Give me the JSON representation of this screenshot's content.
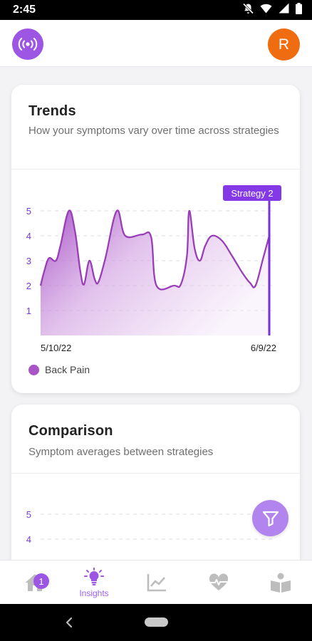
{
  "status_bar": {
    "time": "2:45"
  },
  "header": {
    "avatar_initial": "R",
    "logo_icon": "broadcast-icon"
  },
  "trends": {
    "title": "Trends",
    "subtitle": "How your symptoms vary over time across strategies",
    "strategy_marker": "Strategy 2",
    "legend": {
      "label": "Back Pain",
      "color": "#a855c7"
    }
  },
  "comparison": {
    "title": "Comparison",
    "subtitle": "Symptom averages between strategies",
    "y_ticks": [
      "5",
      "4"
    ]
  },
  "nav": {
    "items": [
      {
        "icon": "home-icon",
        "label": "",
        "badge": "1"
      },
      {
        "icon": "lightbulb-icon",
        "label": "Insights"
      },
      {
        "icon": "line-chart-icon",
        "label": ""
      },
      {
        "icon": "heartbeat-icon",
        "label": ""
      },
      {
        "icon": "book-reader-icon",
        "label": ""
      }
    ]
  },
  "colors": {
    "accent": "#9d55e3",
    "avatar": "#ef6c11",
    "series": "#a855c7"
  },
  "chart_data": {
    "type": "area",
    "x_labels": [
      "5/10/22",
      "6/9/22"
    ],
    "y_ticks": [
      1,
      2,
      3,
      4,
      5
    ],
    "ylim": [
      0,
      5
    ],
    "xlim": [
      0,
      30
    ],
    "series": [
      {
        "name": "Back Pain",
        "values": [
          [
            0,
            2
          ],
          [
            0.5,
            2.6
          ],
          [
            1.1,
            3.1
          ],
          [
            2,
            3
          ],
          [
            2.6,
            3.6
          ],
          [
            3.7,
            5
          ],
          [
            4.5,
            4.2
          ],
          [
            5.2,
            2.6
          ],
          [
            5.7,
            2.05
          ],
          [
            6.4,
            3
          ],
          [
            7.1,
            2.25
          ],
          [
            7.6,
            2.15
          ],
          [
            8.5,
            3.1
          ],
          [
            10,
            5
          ],
          [
            11.1,
            4
          ],
          [
            13.3,
            4.05
          ],
          [
            14.5,
            3.95
          ],
          [
            15.2,
            2
          ],
          [
            17.5,
            2
          ],
          [
            18.4,
            2.05
          ],
          [
            19.2,
            3.2
          ],
          [
            19.5,
            5
          ],
          [
            20.2,
            3.5
          ],
          [
            20.9,
            3
          ],
          [
            21.6,
            3.6
          ],
          [
            22.5,
            4
          ],
          [
            23.8,
            3.8
          ],
          [
            25.1,
            3.2
          ],
          [
            26.5,
            2.5
          ],
          [
            27.5,
            2.1
          ],
          [
            28.2,
            2
          ],
          [
            29.2,
            3.1
          ],
          [
            30,
            4
          ]
        ]
      }
    ],
    "grid": "horizontal dashed",
    "marker": {
      "label": "Strategy 2",
      "x": 30
    }
  }
}
